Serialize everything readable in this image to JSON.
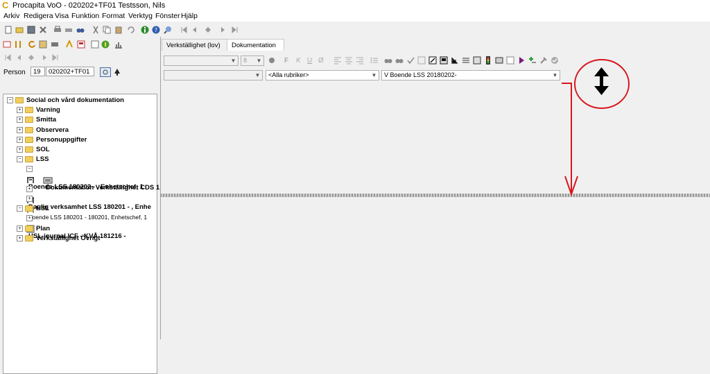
{
  "window": {
    "title": "Procapita VoO - 020202+TF01 Testsson, Nils"
  },
  "menu": [
    "Arkiv",
    "Redigera",
    "Visa",
    "Funktion",
    "Format",
    "Verktyg",
    "Fönster",
    "Hjälp"
  ],
  "person": {
    "label": "Person",
    "century": "19",
    "id": "020202+TF01"
  },
  "tree": {
    "root": "Social och vård dokumentation",
    "items": [
      "Varning",
      "Smitta",
      "Observera",
      "Personuppgifter",
      "SOL",
      "LSS",
      "Boende LSS 180202 - , Enhetschef, 1",
      "Dokumentation Verkställighet CDS 1",
      "Daglig verksamhet LSS 180201 - , Enhe",
      "Boende LSS 180201 - 180201, Enhetschef, 1",
      "HSL",
      "HSL-journal  ICF - KVÅ 181216 -",
      "Plan",
      "Verkställighet Övrigt"
    ]
  },
  "tabs": [
    "Verkställighet (lov)",
    "Dokumentation"
  ],
  "format": {
    "font_size": "8",
    "bold": "F",
    "italic": "K",
    "underline": "U",
    "strike": "Ø"
  },
  "filters": {
    "rubrik": "<Alla rubriker>",
    "plan": "V Boende LSS 20180202-"
  },
  "colors": {
    "annotation": "#d8141c",
    "folder": "#f2cf5b",
    "logo": "#d89a10"
  },
  "icons": [
    "resize-vertical-icon",
    "folder-icon",
    "printer-icon",
    "binoculars-icon",
    "info-icon",
    "help-icon"
  ]
}
